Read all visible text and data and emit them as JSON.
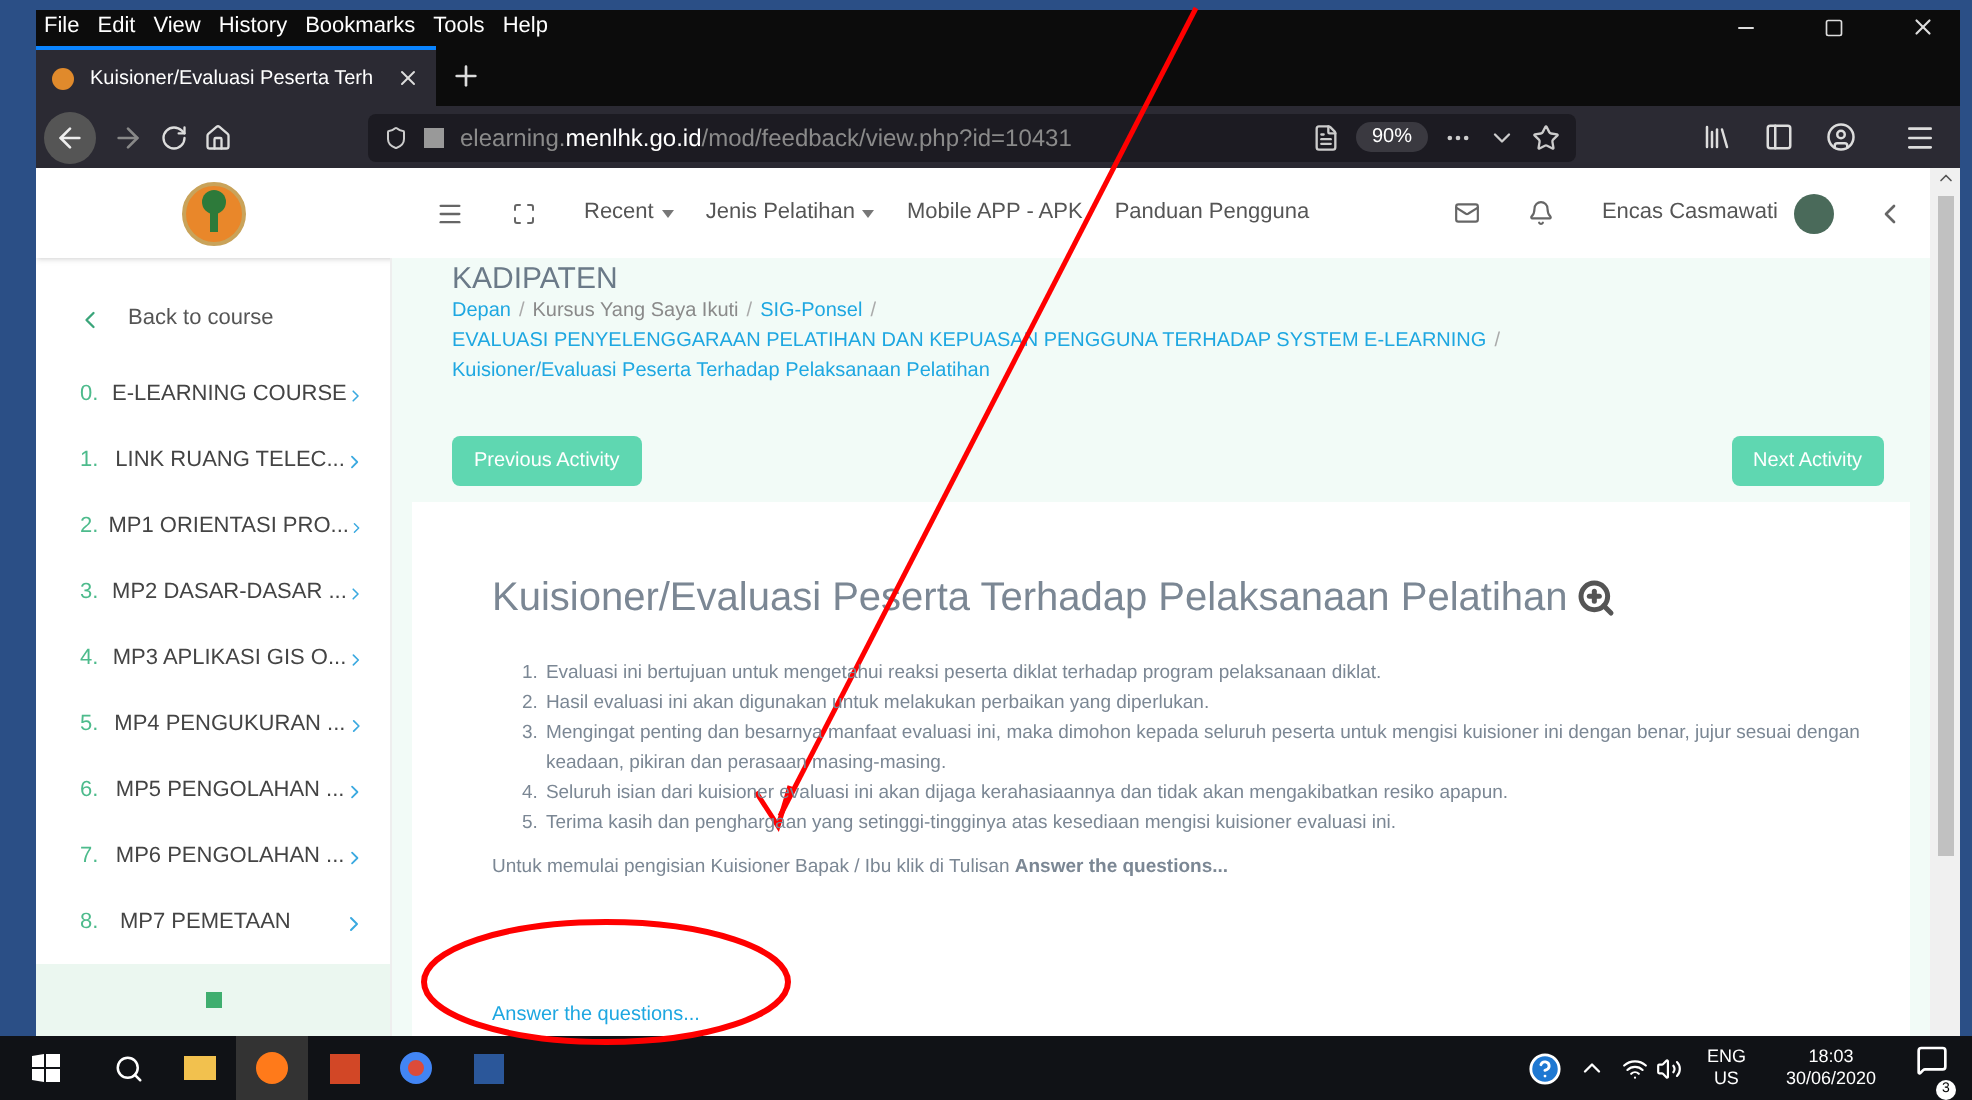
{
  "browser": {
    "menu": [
      "File",
      "Edit",
      "View",
      "History",
      "Bookmarks",
      "Tools",
      "Help"
    ],
    "tab": {
      "title": "Kuisioner/Evaluasi Peserta Terh",
      "selected": true
    },
    "url": {
      "prefix": "elearning.",
      "domain": "menlhk.go.id",
      "path": "/mod/feedback/view.php?id=10431"
    },
    "zoom": "90%"
  },
  "navbar": {
    "items": [
      {
        "label": "Recent",
        "dropdown": true
      },
      {
        "label": "Jenis Pelatihan",
        "dropdown": true
      },
      {
        "label": "Mobile APP - APK",
        "dropdown": false
      },
      {
        "label": "Panduan Pengguna",
        "dropdown": false
      }
    ],
    "user": "Encas Casmawati"
  },
  "sidebar": {
    "back": "Back to course",
    "items": [
      {
        "num": "0.",
        "label": "E-LEARNING COURSE"
      },
      {
        "num": "1.",
        "label": "LINK RUANG TELEC..."
      },
      {
        "num": "2.",
        "label": "MP1 ORIENTASI PRO..."
      },
      {
        "num": "3.",
        "label": "MP2 DASAR-DASAR ..."
      },
      {
        "num": "4.",
        "label": "MP3 APLIKASI GIS O..."
      },
      {
        "num": "5.",
        "label": "MP4 PENGUKURAN ..."
      },
      {
        "num": "6.",
        "label": "MP5 PENGOLAHAN ..."
      },
      {
        "num": "7.",
        "label": "MP6 PENGOLAHAN ..."
      },
      {
        "num": "8.",
        "label": "MP7 PEMETAAN"
      }
    ]
  },
  "content": {
    "heading": "KADIPATEN",
    "breadcrumb": {
      "separator": "/",
      "items": [
        {
          "text": "Depan",
          "link": true
        },
        {
          "text": "Kursus Yang Saya Ikuti",
          "link": false
        },
        {
          "text": "SIG-Ponsel",
          "link": true
        },
        {
          "text": "EVALUASI PENYELENGGARAAN PELATIHAN DAN KEPUASAN PENGGUNA TERHADAP SYSTEM E-LEARNING",
          "link": true
        },
        {
          "text": "Kuisioner/Evaluasi Peserta Terhadap Pelaksanaan Pelatihan",
          "link": true
        }
      ]
    },
    "previous": "Previous Activity",
    "next": "Next Activity",
    "title": "Kuisioner/Evaluasi Peserta Terhadap Pelaksanaan Pelatihan",
    "list": [
      {
        "num": "1.",
        "text": "Evaluasi ini bertujuan untuk mengetahui reaksi peserta diklat terhadap program pelaksanaan diklat."
      },
      {
        "num": "2.",
        "text": "Hasil evaluasi ini akan digunakan untuk melakukan perbaikan yang diperlukan."
      },
      {
        "num": "3.",
        "text": "Mengingat penting dan besarnya manfaat evaluasi ini, maka dimohon kepada seluruh peserta untuk mengisi kuisioner ini dengan benar, jujur sesuai dengan keadaan, pikiran dan perasaan masing-masing."
      },
      {
        "num": "4.",
        "text": "Seluruh isian dari kuisioner evaluasi ini akan dijaga kerahasiaannya dan tidak akan mengakibatkan resiko apapun."
      },
      {
        "num": "5.",
        "text": "Terima kasih dan penghargaan yang setinggi-tingginya atas kesediaan mengisi kuisioner evaluasi ini."
      }
    ],
    "intro": "Untuk memulai pengisian Kuisioner Bapak / Ibu klik di Tulisan **Answer the questions...**",
    "answer_link": "Answer the questions..."
  },
  "taskbar": {
    "lang": "ENG",
    "region": "US",
    "time": "18:03",
    "date": "30/06/2020",
    "notifications": "3"
  }
}
